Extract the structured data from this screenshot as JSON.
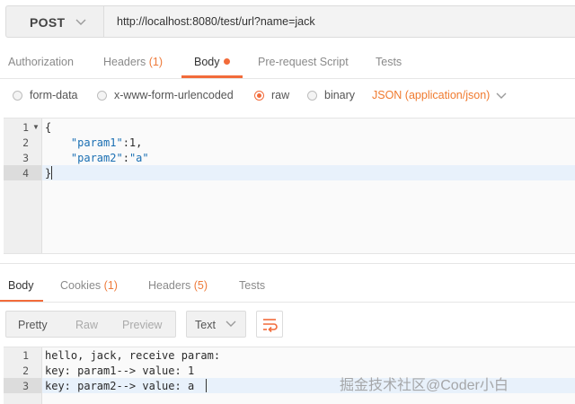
{
  "request": {
    "method": "POST",
    "url": "http://localhost:8080/test/url?name=jack"
  },
  "request_tabs": {
    "authorization": "Authorization",
    "headers": "Headers",
    "headers_count": "(1)",
    "body": "Body",
    "pre_request": "Pre-request Script",
    "tests": "Tests"
  },
  "body_types": {
    "form_data": "form-data",
    "urlencoded": "x-www-form-urlencoded",
    "raw": "raw",
    "binary": "binary",
    "selected": "raw",
    "content_type": "JSON (application/json)"
  },
  "request_body": {
    "line_numbers": [
      "1",
      "2",
      "3",
      "4"
    ],
    "lines": [
      "{",
      "    \"param1\":1,",
      "    \"param2\":\"a\"",
      "}"
    ],
    "line2_key": "\"param1\"",
    "line2_rest": ":1,",
    "line3_key": "\"param2\"",
    "line3_colon": ":",
    "line3_value": "\"a\""
  },
  "response_tabs": {
    "body": "Body",
    "cookies": "Cookies",
    "cookies_count": "(1)",
    "headers": "Headers",
    "headers_count": "(5)",
    "tests": "Tests"
  },
  "response_view": {
    "pretty": "Pretty",
    "raw": "Raw",
    "preview": "Preview",
    "format": "Text"
  },
  "response_body": {
    "line_numbers": [
      "1",
      "2",
      "3"
    ],
    "lines": [
      "hello, jack, receive param:",
      "key: param1--> value: 1",
      "key: param2--> value: a"
    ]
  },
  "watermark": "掘金技术社区@Coder小白",
  "colors": {
    "accent": "#f26b3a",
    "string": "#1a6fb3"
  }
}
